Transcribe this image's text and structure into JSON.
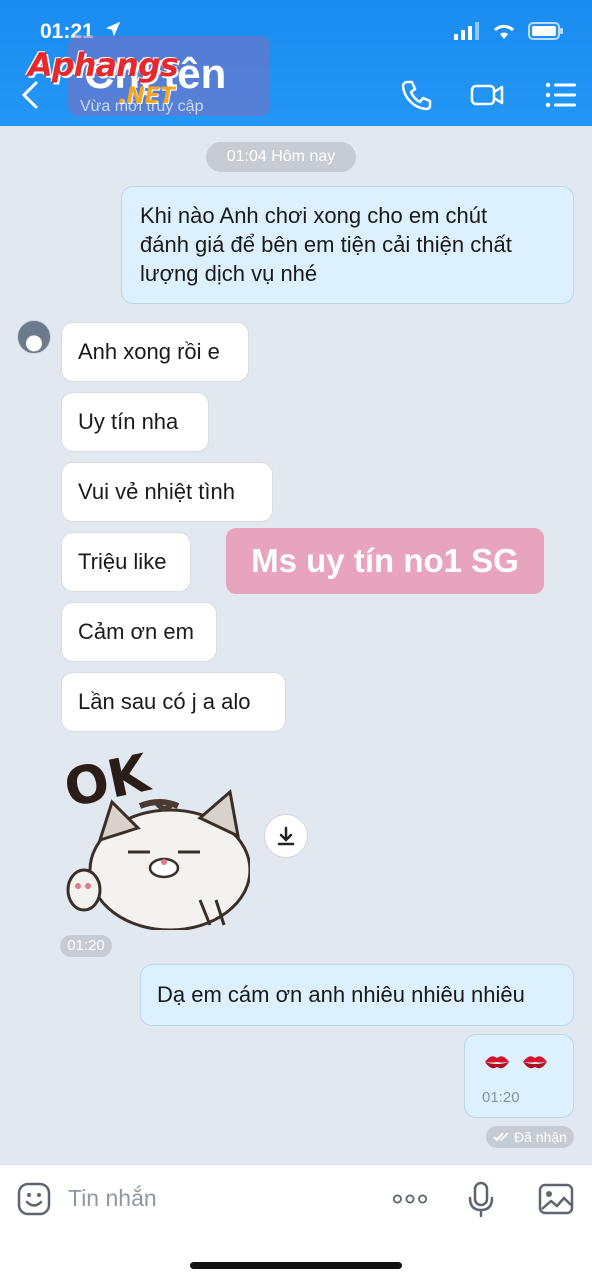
{
  "status_bar": {
    "time": "01:21"
  },
  "header": {
    "title": "Chị tên",
    "subtitle": "Vừa mới truy cập",
    "logo_text": "Aphangs",
    "logo_sub": ".NET",
    "icons": [
      "back-icon",
      "phone-icon",
      "video-icon",
      "menu-icon"
    ],
    "accent": "#1a8cf0"
  },
  "chat": {
    "date_label": "01:04 Hôm nay",
    "outgoing_first": [
      "Khi nào Anh chơi xong cho em chút",
      "đánh giá để bên em tiện cải thiện chất",
      "lượng dịch vụ nhé"
    ],
    "incoming": [
      "Anh xong rồi e",
      "Uy tín nha",
      "Vui vẻ nhiệt tình",
      "Triệu like",
      "Cảm ơn em",
      "Lần sau có j a alo"
    ],
    "sticker_text": "OK",
    "sticker_time": "01:20",
    "outgoing_reply": "Dạ em cám ơn anh nhiêu nhiêu nhiêu",
    "emoji_time": "01:20",
    "received_label": "Đã nhận",
    "watermark": "Ms uy tín no1 SG"
  },
  "input": {
    "placeholder": "Tin nhắn",
    "icons": [
      "emoji-icon",
      "more-icon",
      "mic-icon",
      "image-icon"
    ]
  }
}
